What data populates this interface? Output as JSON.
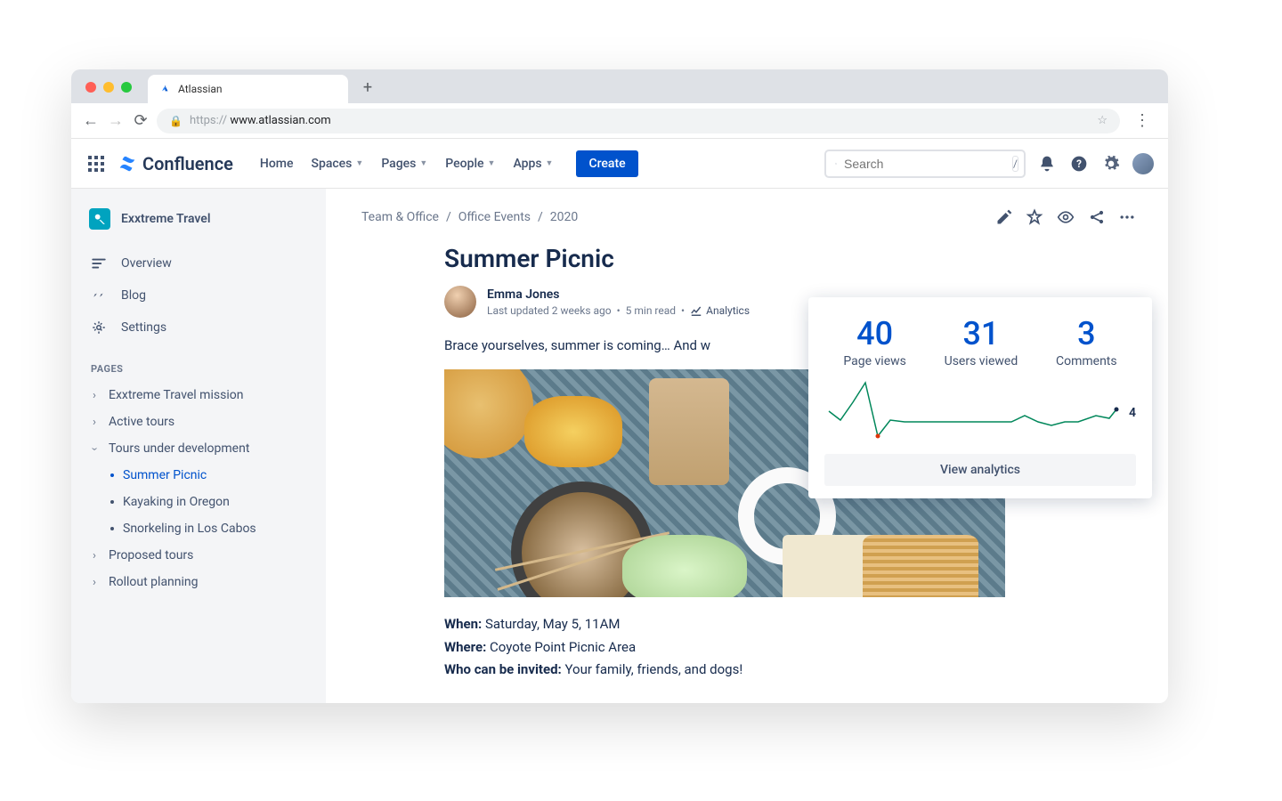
{
  "browser": {
    "tab_title": "Atlassian",
    "url_protocol": "https://",
    "url_host": " www.atlassian.com"
  },
  "header": {
    "product": "Confluence",
    "nav": {
      "home": "Home",
      "spaces": "Spaces",
      "pages": "Pages",
      "people": "People",
      "apps": "Apps"
    },
    "create_label": "Create",
    "search_placeholder": "Search",
    "search_hint": "/"
  },
  "sidebar": {
    "space_name": "Exxtreme Travel",
    "items": {
      "overview": "Overview",
      "blog": "Blog",
      "settings": "Settings"
    },
    "pages_label": "PAGES",
    "tree": {
      "mission": "Exxtreme Travel mission",
      "active": "Active tours",
      "devel": "Tours under development",
      "children": {
        "a": "Summer Picnic",
        "b": "Kayaking in Oregon",
        "c": "Snorkeling in Los Cabos"
      },
      "proposed": "Proposed tours",
      "rollout": "Rollout planning"
    }
  },
  "breadcrumbs": {
    "a": "Team & Office",
    "b": "Office Events",
    "c": "2020"
  },
  "page": {
    "title": "Summer Picnic",
    "author": "Emma Jones",
    "updated": "Last updated 2 weeks ago",
    "read_time": "5 min read",
    "analytics_label": "Analytics",
    "intro": "Brace yourselves, summer is coming… And w",
    "when_label": "When:",
    "when_val": " Saturday, May 5, 11AM",
    "where_label": "Where:",
    "where_val": " Coyote Point Picnic Area",
    "who_label": "Who can be invited:",
    "who_val": " Your family, friends, and dogs!"
  },
  "analytics": {
    "views_n": "40",
    "views_l": "Page views",
    "users_n": "31",
    "users_l": "Users viewed",
    "comments_n": "3",
    "comments_l": "Comments",
    "spark_val": "4",
    "view_btn": "View analytics"
  },
  "chart_data": {
    "type": "line",
    "title": "",
    "values": [
      5,
      3,
      6,
      12,
      1,
      4,
      4,
      4,
      4,
      4,
      4,
      4,
      4,
      5,
      4,
      3,
      4,
      4,
      5,
      4
    ],
    "ylim": [
      0,
      12
    ],
    "current": 4
  }
}
